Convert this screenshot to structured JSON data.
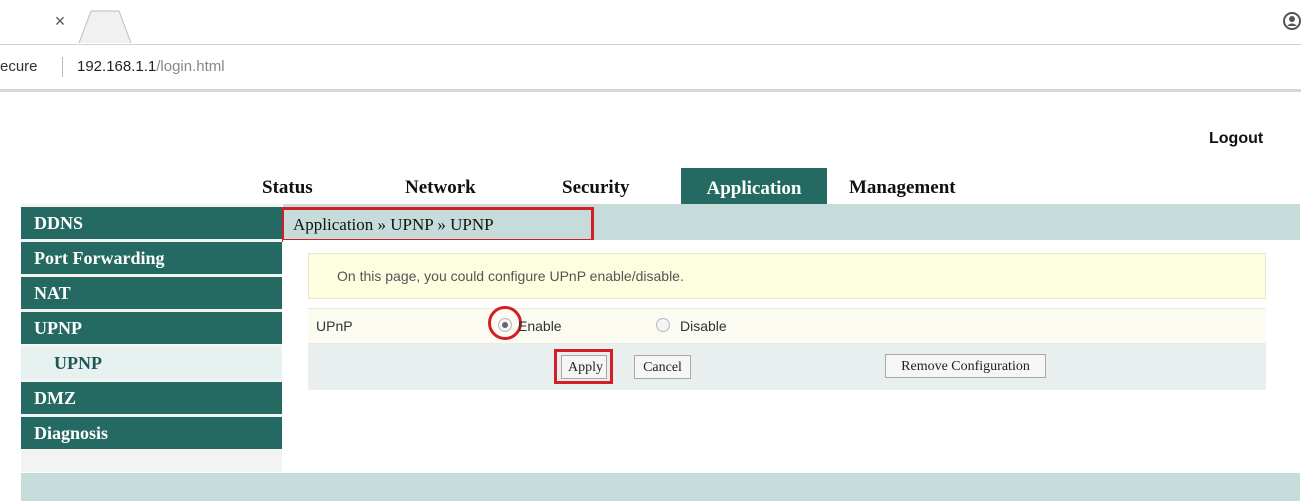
{
  "browser": {
    "tab_close": "×",
    "secure_label": "ecure",
    "url_host": "192.168.1.1",
    "url_path": "/login.html"
  },
  "header": {
    "logout": "Logout"
  },
  "topnav": [
    {
      "label": "Status"
    },
    {
      "label": "Network"
    },
    {
      "label": "Security"
    },
    {
      "label": "Application"
    },
    {
      "label": "Management"
    }
  ],
  "breadcrumb": "Application » UPNP » UPNP",
  "sidebar": {
    "items": [
      {
        "label": "DDNS"
      },
      {
        "label": "Port Forwarding"
      },
      {
        "label": "NAT"
      },
      {
        "label": "UPNP"
      },
      {
        "label": "UPNP"
      },
      {
        "label": "DMZ"
      },
      {
        "label": "Diagnosis"
      }
    ]
  },
  "main": {
    "info": "On this page, you could configure UPnP enable/disable.",
    "field_label": "UPnP",
    "enable_label": "Enable",
    "disable_label": "Disable",
    "selected": "Enable"
  },
  "buttons": {
    "apply": "Apply",
    "cancel": "Cancel",
    "remove": "Remove Configuration"
  },
  "colors": {
    "primary_teal": "#256963",
    "light_teal": "#c6dcda",
    "highlight_red": "#d21f26",
    "info_yellow": "#fdfde0"
  },
  "icons": {
    "tab_close": "close-icon",
    "new_tab": "new-tab-icon",
    "profile": "profile-icon"
  }
}
